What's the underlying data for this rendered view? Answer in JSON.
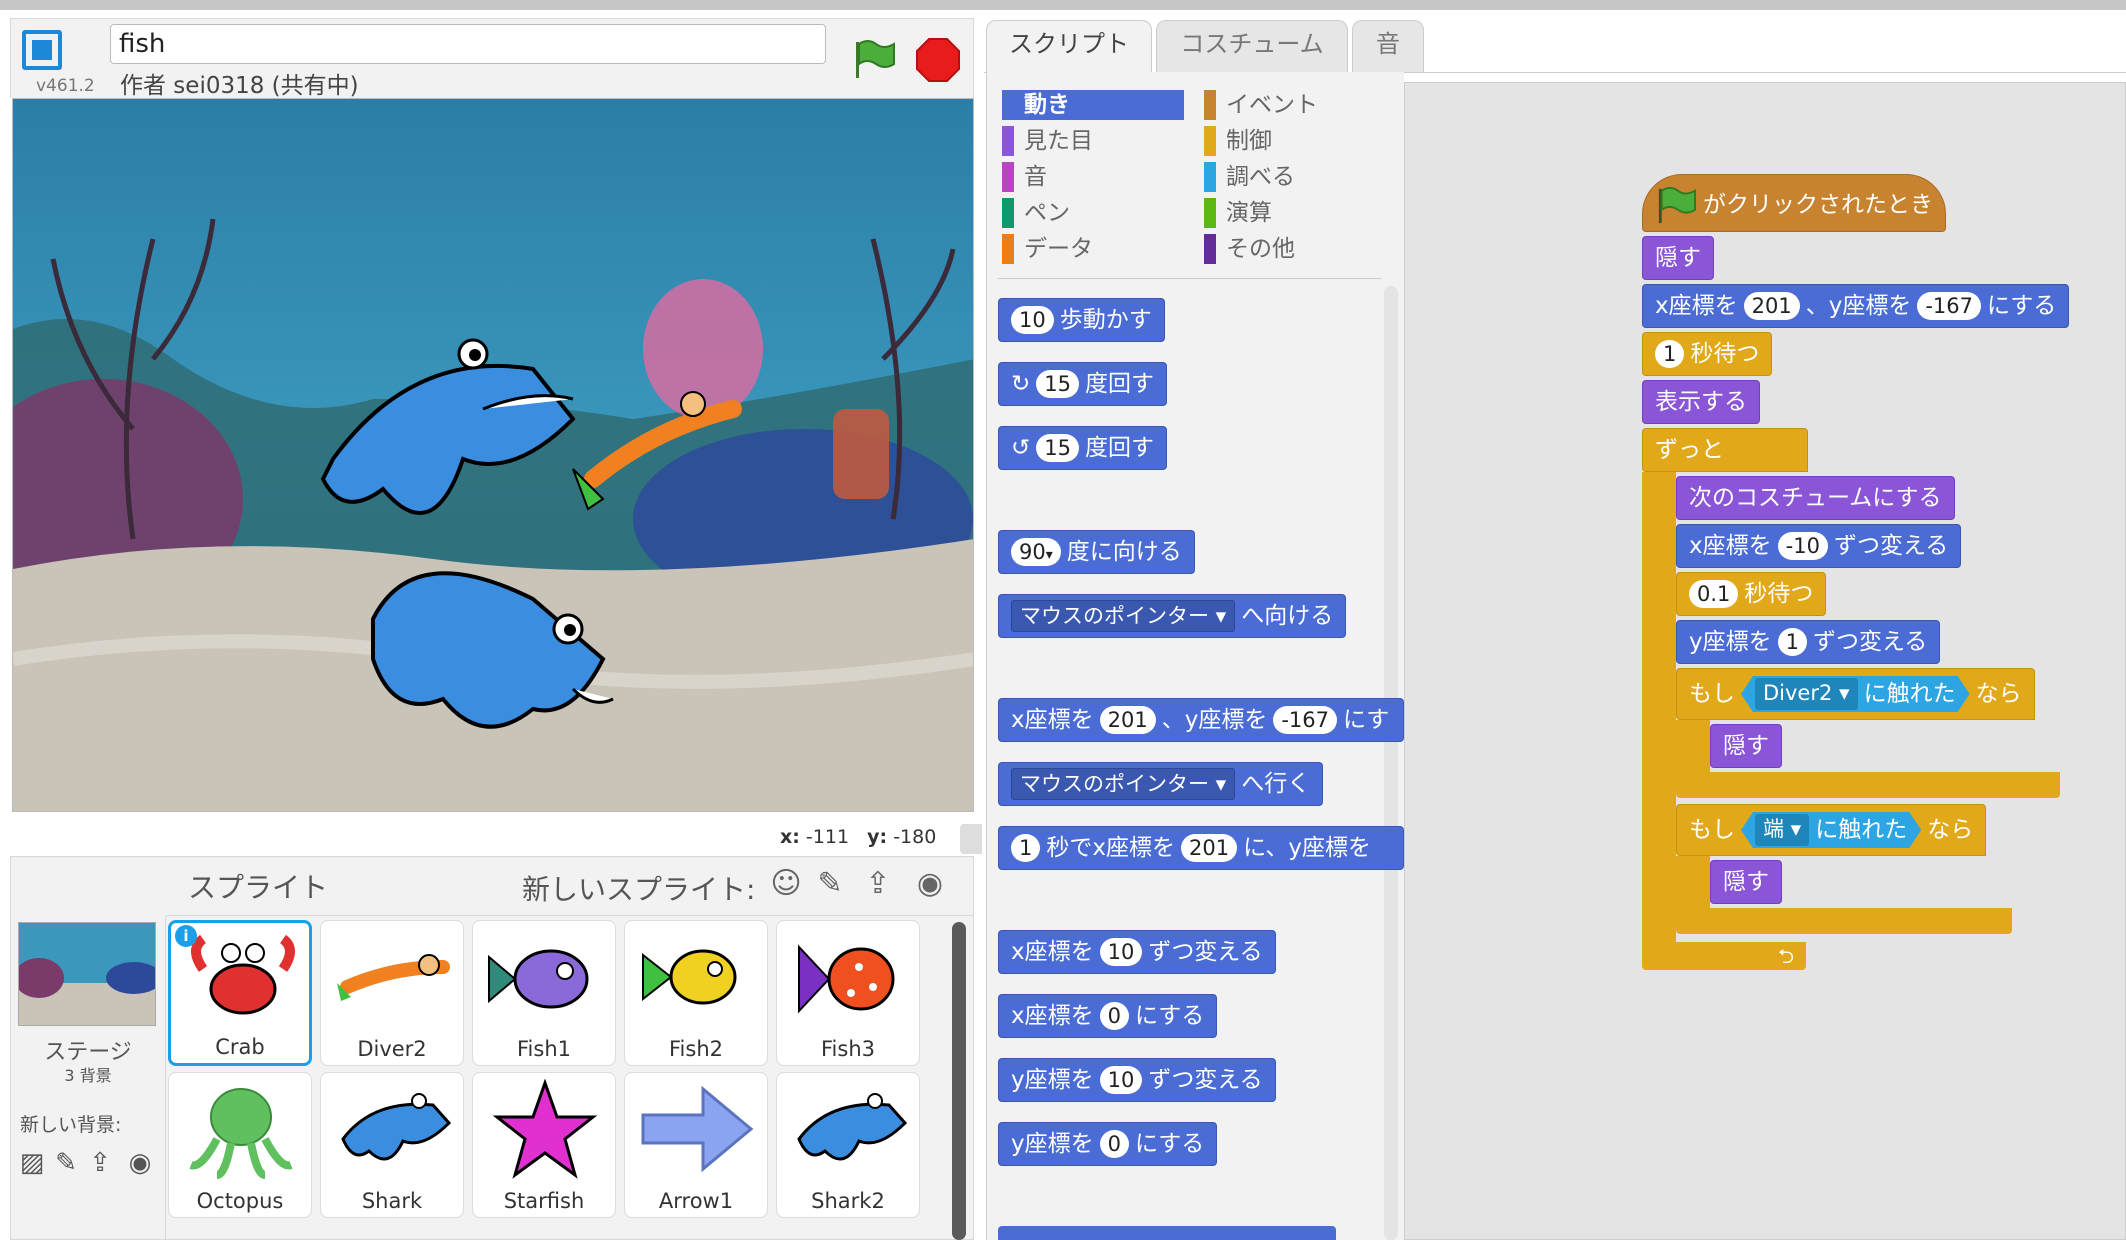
{
  "project": {
    "title": "fish",
    "author": "作者 sei0318 (共有中)",
    "version": "v461.2"
  },
  "stage": {
    "coords": {
      "x_label": "x:",
      "x_value": "-111",
      "y_label": "y:",
      "y_value": "-180"
    }
  },
  "sprite_pane": {
    "title": "スプライト",
    "new_sprite_label": "新しいスプライト:",
    "stage_label": "ステージ",
    "stage_bg_count": "3 背景",
    "new_bg_label": "新しい背景:",
    "sprites": [
      {
        "name": "Crab",
        "selected": true,
        "color": "#e03030"
      },
      {
        "name": "Diver2",
        "selected": false,
        "color": "#f08020"
      },
      {
        "name": "Fish1",
        "selected": false,
        "color": "#8a6ad8"
      },
      {
        "name": "Fish2",
        "selected": false,
        "color": "#f0d020"
      },
      {
        "name": "Fish3",
        "selected": false,
        "color": "#f05020"
      },
      {
        "name": "Octopus",
        "selected": false,
        "color": "#60c060"
      },
      {
        "name": "Shark",
        "selected": false,
        "color": "#3b8de0"
      },
      {
        "name": "Starfish",
        "selected": false,
        "color": "#e030d0"
      },
      {
        "name": "Arrow1",
        "selected": false,
        "color": "#8aa4f0"
      },
      {
        "name": "Shark2",
        "selected": false,
        "color": "#3b8de0"
      }
    ]
  },
  "tabs": [
    "スクリプト",
    "コスチューム",
    "音"
  ],
  "categories": {
    "left": [
      {
        "label": "動き",
        "color": "#4a6cd4",
        "active": true
      },
      {
        "label": "見た目",
        "color": "#8a55d7",
        "active": false
      },
      {
        "label": "音",
        "color": "#bb42c3",
        "active": false
      },
      {
        "label": "ペン",
        "color": "#0e9a6c",
        "active": false
      },
      {
        "label": "データ",
        "color": "#ee7d16",
        "active": false
      }
    ],
    "right": [
      {
        "label": "イベント",
        "color": "#c88330"
      },
      {
        "label": "制御",
        "color": "#e1a91a"
      },
      {
        "label": "調べる",
        "color": "#2ca5e2"
      },
      {
        "label": "演算",
        "color": "#5cb712"
      },
      {
        "label": "その他",
        "color": "#632d99"
      }
    ]
  },
  "palette_blocks": {
    "move": {
      "value": "10",
      "text": "歩動かす"
    },
    "turn_right": {
      "value": "15",
      "text": "度回す"
    },
    "turn_left": {
      "value": "15",
      "text": "度回す"
    },
    "point_dir": {
      "value": "90",
      "text": "度に向ける"
    },
    "point_towards": {
      "dropdown": "マウスのポインター",
      "text": "へ向ける"
    },
    "goto_xy": {
      "t1": "x座標を",
      "v1": "201",
      "t2": "、y座標を",
      "v2": "-167",
      "t3": "にす"
    },
    "goto": {
      "dropdown": "マウスのポインター",
      "text": "へ行く"
    },
    "glide": {
      "v1": "1",
      "t1": "秒でx座標を",
      "v2": "201",
      "t2": "に、y座標を"
    },
    "change_x": {
      "t1": "x座標を",
      "value": "10",
      "t2": "ずつ変える"
    },
    "set_x": {
      "t1": "x座標を",
      "value": "0",
      "t2": "にする"
    },
    "change_y": {
      "t1": "y座標を",
      "value": "10",
      "t2": "ずつ変える"
    },
    "set_y": {
      "t1": "y座標を",
      "value": "0",
      "t2": "にする"
    }
  },
  "script": {
    "hat": "がクリックされたとき",
    "hide1": "隠す",
    "goto": {
      "t1": "x座標を",
      "v1": "201",
      "t2": "、y座標を",
      "v2": "-167",
      "t3": "にする"
    },
    "wait1": {
      "value": "1",
      "text": "秒待つ"
    },
    "show": "表示する",
    "forever": "ずっと",
    "next_costume": "次のコスチュームにする",
    "change_x": {
      "t1": "x座標を",
      "value": "-10",
      "t2": "ずつ変える"
    },
    "wait2": {
      "value": "0.1",
      "text": "秒待つ"
    },
    "change_y": {
      "t1": "y座標を",
      "value": "1",
      "t2": "ずつ変える"
    },
    "if1": {
      "if": "もし",
      "target": "Diver2",
      "touch": "に触れた",
      "then": "なら",
      "body": "隠す"
    },
    "if2": {
      "if": "もし",
      "target": "端",
      "touch": "に触れた",
      "then": "なら",
      "body": "隠す"
    }
  }
}
